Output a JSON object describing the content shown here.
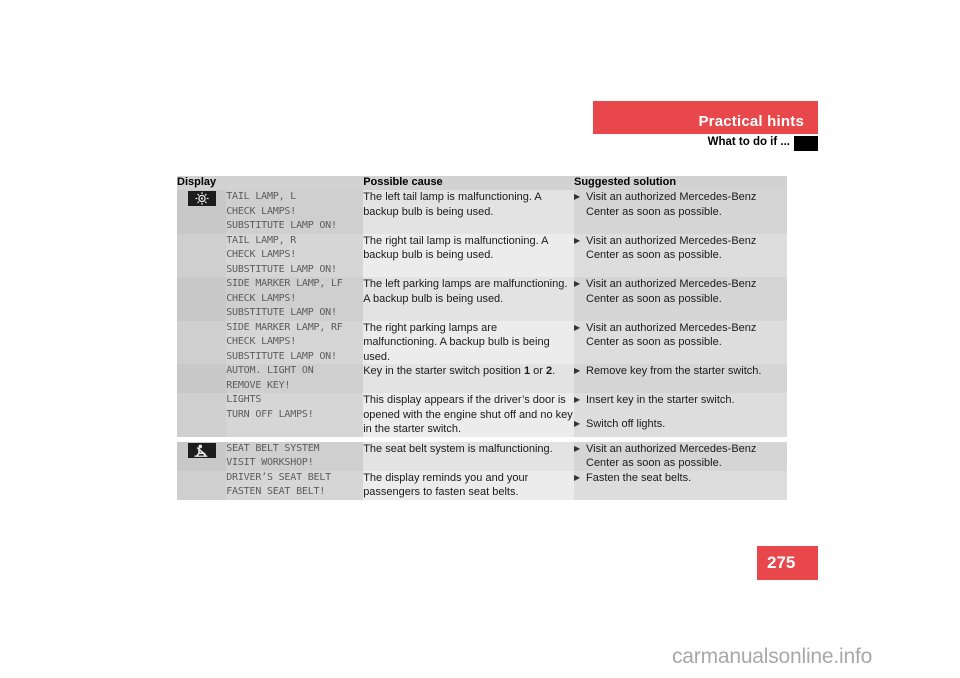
{
  "header": {
    "band_title": "Practical hints",
    "sub_title": "What to do if ...",
    "band_color": "#e8474b",
    "marker_color": "#000000"
  },
  "table": {
    "columns": [
      {
        "key": "icon",
        "label": ""
      },
      {
        "key": "display",
        "label": "Display"
      },
      {
        "key": "cause",
        "label": "Possible cause"
      },
      {
        "key": "solution",
        "label": "Suggested solution"
      }
    ],
    "rows": [
      {
        "icon": "lamp-indicator-icon",
        "display": "TAIL LAMP, L\nCHECK LAMPS!\nSUBSTITUTE LAMP ON!",
        "cause": "The left tail lamp is malfunctioning. A backup bulb is being used.",
        "solutions": [
          "Visit an authorized Mercedes-Benz Center as soon as possible."
        ]
      },
      {
        "icon": "",
        "display": "TAIL LAMP, R\nCHECK LAMPS!\nSUBSTITUTE LAMP ON!",
        "cause": "The right tail lamp is malfunctioning. A backup bulb is being used.",
        "solutions": [
          "Visit an authorized Mercedes-Benz Center as soon as possible."
        ]
      },
      {
        "icon": "",
        "display": "SIDE MARKER LAMP, LF\nCHECK LAMPS!\nSUBSTITUTE LAMP ON!",
        "cause": "The left parking lamps are malfunctioning. A backup bulb is being used.",
        "solutions": [
          "Visit an authorized Mercedes-Benz Center as soon as possible."
        ]
      },
      {
        "icon": "",
        "display": "SIDE MARKER LAMP, RF\nCHECK LAMPS!\nSUBSTITUTE LAMP ON!",
        "cause": "The right parking lamps are malfunctioning. A backup bulb is being used.",
        "solutions": [
          "Visit an authorized Mercedes-Benz Center as soon as possible."
        ]
      },
      {
        "icon": "",
        "display": "AUTOM. LIGHT ON\nREMOVE KEY!",
        "cause_parts": [
          {
            "text": "Key in the starter switch position ",
            "bold": false
          },
          {
            "text": "1",
            "bold": true
          },
          {
            "text": " or ",
            "bold": false
          },
          {
            "text": "2",
            "bold": true
          },
          {
            "text": ".",
            "bold": false
          }
        ],
        "cause": "Key in the starter switch position 1 or 2.",
        "solutions": [
          "Remove key from the starter switch."
        ]
      },
      {
        "icon": "",
        "display": "LIGHTS\nTURN OFF LAMPS!",
        "cause": "This display appears if the driver’s door is opened with the engine shut off and no key in the starter switch.",
        "solutions": [
          "Insert key in the starter switch.",
          "Switch off lights."
        ]
      },
      {
        "separator_before": true,
        "icon": "seat-belt-icon",
        "display": "SEAT BELT SYSTEM\nVISIT WORKSHOP!",
        "cause": "The seat belt system is malfunctioning.",
        "solutions": [
          "Visit an authorized Mercedes-Benz Center as soon as possible."
        ]
      },
      {
        "icon": "",
        "display": "DRIVER’S SEAT BELT\nFASTEN SEAT BELT!",
        "cause": "The display reminds you and your passengers to fasten seat belts.",
        "solutions": [
          "Fasten the seat belts."
        ]
      }
    ]
  },
  "page": {
    "number": "275",
    "number_color": "#e8474b"
  },
  "watermark": {
    "text": "carmanualsonline.info"
  }
}
